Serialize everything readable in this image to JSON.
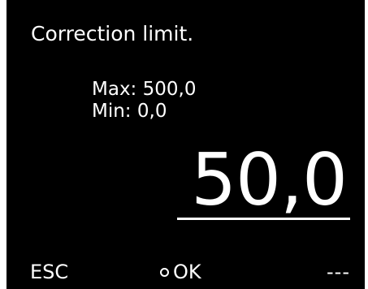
{
  "screen": {
    "title": "Correction limit.",
    "max_label": "Max: 500,0",
    "min_label": "Min: 0,0",
    "value": "50,0"
  },
  "softkeys": {
    "left_label": "ESC",
    "middle_icon": "ring-icon",
    "middle_label": "OK",
    "right_label": "---"
  },
  "colors": {
    "background": "#000000",
    "foreground": "#ffffff"
  }
}
